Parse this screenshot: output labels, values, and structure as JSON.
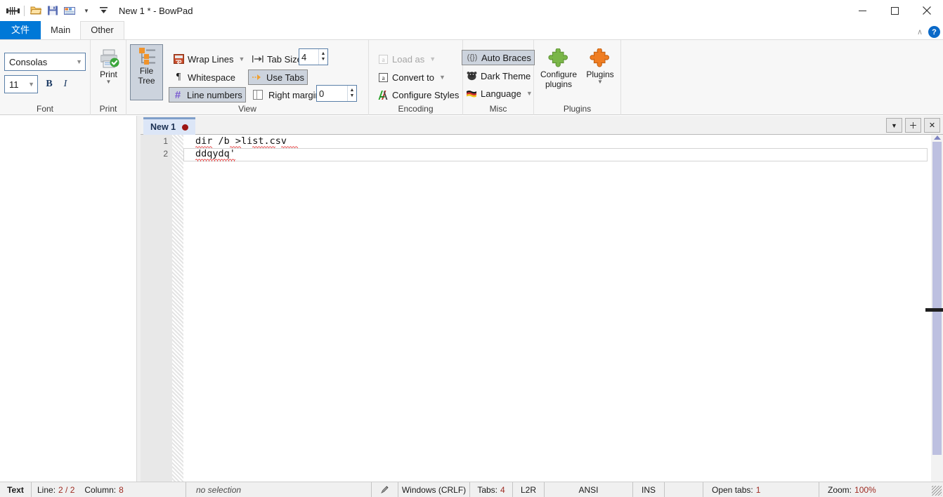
{
  "window": {
    "title": "New 1 *  - BowPad",
    "quick_access": [
      {
        "name": "bowpad-logo-icon",
        "label": "BowPad"
      },
      {
        "name": "open-file-icon",
        "label": "Open"
      },
      {
        "name": "save-icon",
        "label": "Save"
      },
      {
        "name": "tabs-icon",
        "label": "Tabs"
      },
      {
        "name": "customize-qat-icon",
        "label": "Customize Quick Access Toolbar"
      }
    ],
    "controls": [
      {
        "name": "minimize-button",
        "glyph": "─"
      },
      {
        "name": "maximize-button",
        "glyph": "□"
      },
      {
        "name": "close-button",
        "glyph": "✕"
      }
    ]
  },
  "ribbon": {
    "tabs": [
      {
        "label": "文件",
        "state": "file"
      },
      {
        "label": "Main",
        "state": "normal"
      },
      {
        "label": "Other",
        "state": "active"
      }
    ],
    "collapse_label": "∧",
    "help_label": "?",
    "groups": [
      {
        "name": "font",
        "label": "Font",
        "font_name": "Consolas",
        "font_size": "11",
        "bold_label": "B",
        "italic_label": "I"
      },
      {
        "name": "print",
        "label": "Print",
        "print_label": "Print"
      },
      {
        "name": "view",
        "label": "View",
        "file_tree_label_line1": "File",
        "file_tree_label_line2": "Tree",
        "wrap_lines_label": "Wrap Lines",
        "whitespace_label": "Whitespace",
        "line_numbers_label": "Line numbers",
        "tab_size_label": "Tab Size",
        "tab_size_value": "4",
        "use_tabs_label": "Use Tabs",
        "right_margin_label": "Right margin",
        "right_margin_value": "0"
      },
      {
        "name": "encoding",
        "label": "Encoding",
        "load_as_label": "Load as",
        "convert_to_label": "Convert to",
        "configure_styles_label": "Configure Styles"
      },
      {
        "name": "misc",
        "label": "Misc",
        "auto_braces_label": "Auto Braces",
        "dark_theme_label": "Dark Theme",
        "language_label": "Language"
      },
      {
        "name": "plugins",
        "label": "Plugins",
        "configure_plugins_line1": "Configure",
        "configure_plugins_line2": "plugins",
        "plugins_label": "Plugins"
      }
    ]
  },
  "doc_tabs": {
    "tabs": [
      {
        "name": "New 1",
        "modified": true
      }
    ],
    "buttons": [
      {
        "name": "tab-list-dropdown-button",
        "glyph": "▼"
      },
      {
        "name": "new-tab-button",
        "glyph": "＋"
      },
      {
        "name": "close-tab-button",
        "glyph": "✕"
      }
    ]
  },
  "editor": {
    "lines": [
      {
        "number": "1",
        "text": "dir /b >list.csv"
      },
      {
        "number": "2",
        "text": "ddqydq'"
      }
    ]
  },
  "statusbar": {
    "doc_type": "Text",
    "line_label": "Line:",
    "line_value": "2 / 2",
    "column_label": "Column:",
    "column_value": "8",
    "selection": "no selection",
    "edit_icon_name": "pen-icon",
    "eol": "Windows (CRLF)",
    "tabs_label": "Tabs:",
    "tabs_value": "4",
    "direction": "L2R",
    "encoding": "ANSI",
    "insert_mode": "INS",
    "blank": "",
    "open_tabs_label": "Open tabs:",
    "open_tabs_value": "1",
    "zoom_label": "Zoom:",
    "zoom_value": "100%"
  },
  "colors": {
    "accent": "#0078d7",
    "tab_active": "#dce6f7",
    "status_value": "#9e2b22",
    "scrollbar_thumb": "#bdc0e0"
  }
}
